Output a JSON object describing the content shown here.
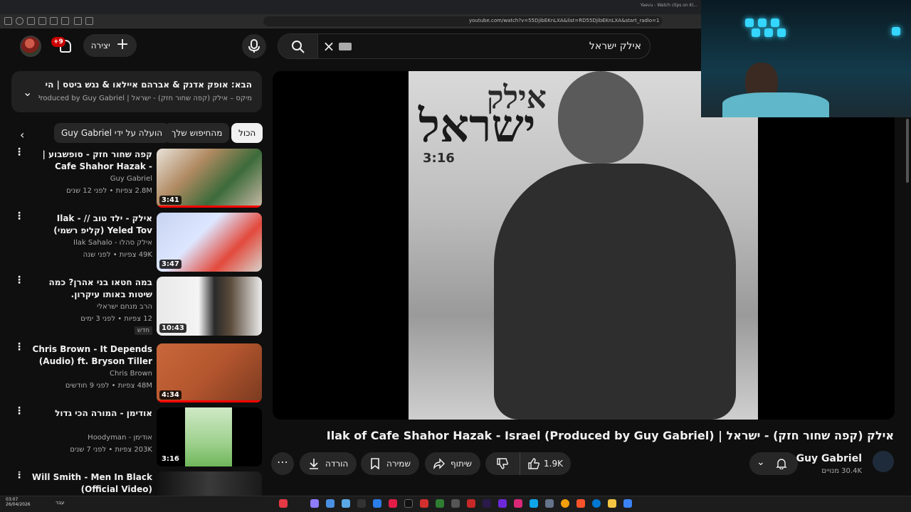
{
  "browser": {
    "tab_title": "Yaevu - Watch clips on Ki...",
    "url": "youtube.com/watch?v=55DjibEKnLXA&list=RD55DjibEKnLXA&start_radio=1"
  },
  "header": {
    "notification_count": "+9",
    "create_label": "יצירה",
    "search_value": "אילק ישראל"
  },
  "next_up": {
    "title": "הבא: אופק אדנק & אברהם איילאו & נגש ביטס | היי גיאל X ...",
    "subtitle": "מיקס – אילק (קפה שחור חזק) - ישראל | Produced by Guy Gabriel)..."
  },
  "chips": [
    "הכול",
    "מהחיפוש שלך",
    "הועלה על ידי Guy Gabriel"
  ],
  "suggestions": [
    {
      "title": "קפה שחור חזק - סופשבוע | Cafe Shahor Hazak - Sofshavua ...",
      "channel": "Guy Gabriel",
      "meta": "2.8M צפיות • לפני 12 שנים",
      "duration": "3:41",
      "tag": ""
    },
    {
      "title": "אילק - ילד טוב // Ilak - Yeled Tov (קליפ רשמי)",
      "channel": "אילק סהלו - Ilak Sahalo",
      "meta": "49K צפיות • לפני שנה",
      "duration": "3:47",
      "tag": ""
    },
    {
      "title": "במה חטאו בני אהרן? כמה שיטות באותו עיקרון.",
      "channel": "הרב מנחם ישראלי",
      "meta": "12 צפיות • לפני 3 ימים",
      "duration": "10:43",
      "tag": "חדש"
    },
    {
      "title": "Chris Brown - It Depends (Audio) ft. Bryson Tiller",
      "channel": "Chris Brown",
      "meta": "48M צפיות • לפני 9 חודשים",
      "duration": "4:34",
      "tag": ""
    },
    {
      "title": "אודימן - המורה הכי גדול",
      "channel": "אודימן - Hoodyman",
      "meta": "203K צפיות • לפני 7 שנים",
      "duration": "3:16",
      "tag": ""
    },
    {
      "title": "Will Smith - Men In Black (Official Video)",
      "channel": "",
      "meta": "",
      "duration": "",
      "tag": ""
    }
  ],
  "player": {
    "art_line1": "אילק",
    "art_line2": "ישראל",
    "art_duration": "3:16"
  },
  "video": {
    "title": "אילק (קפה שחור חזק) - ישראל | Ilak of Cafe Shahor Hazak - Israel (Produced by Guy Gabriel)",
    "likes": "1.9K",
    "share_label": "שיתוף",
    "save_label": "שמירה",
    "download_label": "הורדה",
    "channel_name": "Guy Gabriel",
    "channel_subs": "30.4K מנויים"
  },
  "taskbar": {
    "time": "03:07",
    "date": "26/04/2026",
    "lang": "עבר"
  },
  "colors": {
    "background": "#0f0f0f",
    "surface": "#272727",
    "accent_red": "#ff0000",
    "webcam_glow": "#35d6ff"
  }
}
